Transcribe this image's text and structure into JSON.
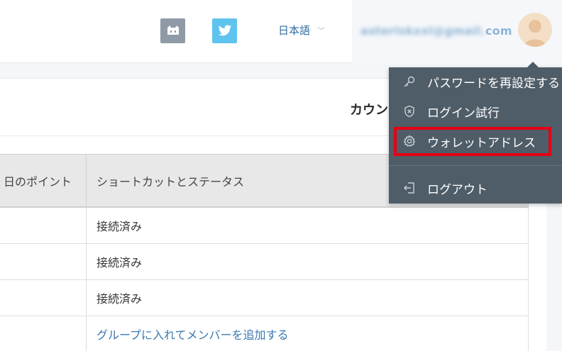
{
  "header": {
    "github_icon": "github-icon",
    "twitter_icon": "twitter-icon",
    "language_label": "日本語",
    "email_hidden": "asteriskxxl@gmail.",
    "email_suffix": "com"
  },
  "card": {
    "title": "カウン"
  },
  "table": {
    "columns": [
      "日のポイント",
      "ショートカットとステータス"
    ],
    "rows": [
      {
        "c1": "",
        "c2": "接続済み"
      },
      {
        "c1": "",
        "c2": "接続済み"
      },
      {
        "c1": "",
        "c2": "接続済み"
      },
      {
        "c1": "",
        "c2": "グループに入れてメンバーを追加する"
      }
    ]
  },
  "menu": {
    "items": [
      {
        "label": "パスワードを再設定する",
        "icon": "key-icon"
      },
      {
        "label": "ログイン試行",
        "icon": "shield-icon"
      },
      {
        "label": "ウォレットアドレス",
        "icon": "gear-icon"
      },
      {
        "label": "ログアウト",
        "icon": "logout-icon"
      }
    ]
  },
  "colors": {
    "menu_bg": "#4f5d68",
    "highlight": "#e60012",
    "link": "#3a78b0",
    "twitter": "#5fc3ef",
    "github": "#8f9aa6"
  }
}
